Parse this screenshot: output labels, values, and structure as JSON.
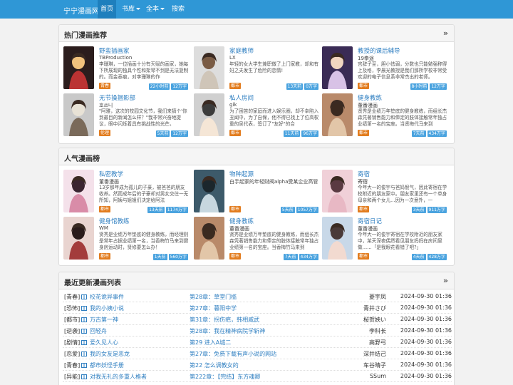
{
  "navbar": {
    "brand": "宁宁漫画网",
    "items": [
      {
        "label": "首页",
        "active": true
      },
      {
        "label": "书库",
        "dropdown": true
      },
      {
        "label": "全本",
        "dropdown": true
      },
      {
        "label": "搜索"
      }
    ]
  },
  "hot": {
    "title": "热门漫画推荐",
    "items": [
      {
        "title": "野蛮插画家",
        "author": "TBProduction",
        "desc": "李珊琳，一位插画十分有天赋的画家，她每下所展现的独具个性和架琴不到是无法复制的。而金泰痕，对李珊琳的作",
        "cat": "青春",
        "tags": [
          "22小时前",
          "12万字"
        ]
      },
      {
        "title": "家庭教师",
        "author": "LX",
        "desc": "年轻的女大学生兼职做了上门家教，却和有妇之夫发生了危险的恋情!",
        "cat": "都市",
        "tags": [
          "13天前",
          "0万字"
        ]
      },
      {
        "title": "教授的课后辅导",
        "author": "19拳途",
        "desc": "宫辞子至，胆小怯弱，分数也只能勉强称得上及格，李晨光教授是我们那所学校非常受欢迎的电子信息系非常杰出的老师。",
        "cat": "都市",
        "tags": [
          "8小时前",
          "12万字"
        ]
      },
      {
        "title": "无节操捆影部",
        "author": "호쓰니",
        "desc": "\"阿雅，这次的校园文化节，我们来搞个'你到最目的新闻怎么样？\"我非常兴奋地提议，眼中闪烁着具有挑战性的光芒。",
        "cat": "伦理",
        "tags": [
          "5天前",
          "12万字"
        ]
      },
      {
        "title": "私人房间",
        "author": "gik",
        "desc": "为了困苦的家庭而进入娱乐圈，却不幸陷入丑闻中，为了自保，他不得已找上了位高权重的吴代表，签订了\"友好\"的合",
        "cat": "都市",
        "tags": [
          "11天前",
          "96万字"
        ]
      },
      {
        "title": "健身教练",
        "author": "董番漫画",
        "desc": "贤秀是业绩万年垫底的健身教练，而组长杰森凭著销售能力和俸定的肢体接触常年独占业绩第一名的宝座。当贤梅代马来到",
        "cat": "都市",
        "tags": [
          "7天前",
          "434万字"
        ]
      }
    ]
  },
  "popular": {
    "title": "人气漫画榜",
    "items": [
      {
        "title": "私密教学",
        "author": "董番漫画",
        "desc": "13岁那年成为孤儿的子豪，被爸爸的朋友收养。然而成年后的子豪却对男女交往一无所知，阿姨与姐姐们决定给阿法",
        "cat": "都市",
        "tags": [
          "13天前",
          "1174万字"
        ]
      },
      {
        "title": "物种起源",
        "author": "白手起家的年轻财阀alpha受某企业高管的秘密委托，依在即将在上海召开的秘密竞拍中拍下一个武器。 但是因某人从",
        "desc": "",
        "cat": "都市",
        "tags": [
          "5天前",
          "1057万字"
        ]
      },
      {
        "title": "寄宿",
        "author": "寄宿",
        "desc": "今年大一的俊宇与爸妈恨气，因此寄宿在学校附近的朋友家中。朋友家里还有一个单身母亲和两个女儿...因为一次意外，一",
        "cat": "都市",
        "tags": [
          "3天前",
          "911万字"
        ]
      },
      {
        "title": "健身馆教练",
        "author": "WM",
        "desc": "贤秀是业绩万年垫底的健身教练，而经理则是常年占据业绩第一名，当香梅竹马来到健身房运动时，贤修要怎么办！",
        "cat": "都市",
        "tags": [
          "1天前",
          "560万字"
        ]
      },
      {
        "title": "健身教练",
        "author": "董番漫画",
        "desc": "贤秀是业绩万年垫底的健身教练，而组长杰森凭著销售能力和俸定的肢体接触常年独占业绩第一名的宝座。当香梅竹马来到",
        "cat": "都市",
        "tags": [
          "7天前",
          "434万字"
        ]
      },
      {
        "title": "寄宿日记",
        "author": "董番漫画",
        "desc": "今年大一的俊宇寄宿在学校附近的朋友家中，某天深夜偶然看见朋友妈妈在房间里做……「是我眼花看错了吧?」",
        "cat": "都市",
        "tags": [
          "4天前",
          "428万字"
        ]
      }
    ]
  },
  "latest": {
    "title": "最近更新漫画列表",
    "rows": [
      {
        "cat": "[青春]",
        "title": "校花诡异事件",
        "chap": "第28章：草堂门槛",
        "author": "菱宇凤",
        "time": "2024-09-30 01:36"
      },
      {
        "cat": "[恐怖]",
        "title": "我的小姨小说",
        "chap": "第27章：暮阳中学",
        "author": "青井さび",
        "time": "2024-09-30 01:36"
      },
      {
        "cat": "[都市]",
        "title": "万古第一神",
        "chap": "第31章：拐伤疤，韩相威武",
        "author": "桜贺姎い",
        "time": "2024-09-30 01:36"
      },
      {
        "cat": "[逆袭]",
        "title": "回轻舟",
        "chap": "第28章：我在精神病院学斩神",
        "author": "李科长",
        "time": "2024-09-30 01:36"
      },
      {
        "cat": "[剧情]",
        "title": "爱久见人心",
        "chap": "第29 进入A城二",
        "author": "高野弓",
        "time": "2024-09-30 01:36"
      },
      {
        "cat": "[恋爱]",
        "title": "我的女友是恶龙",
        "chap": "第27章：免费下载有声小说的网站",
        "author": "深井结己",
        "time": "2024-09-30 01:36"
      },
      {
        "cat": "[青春]",
        "title": "都市妖怪手册",
        "chap": "第22 怎么调教女的",
        "author": "车谷晴子",
        "time": "2024-09-30 01:36"
      },
      {
        "cat": "[异能]",
        "title": "对我无礼的多重人格者",
        "chap": "第222章：【完结】东方魂卿",
        "author": "SSum",
        "time": "2024-09-30 01:36"
      }
    ]
  },
  "colors": {
    "navbar": "#2f97d6",
    "link": "#2f7fc1",
    "category_badge": "#e27c1e",
    "tag_badge": "#4aa3df"
  }
}
